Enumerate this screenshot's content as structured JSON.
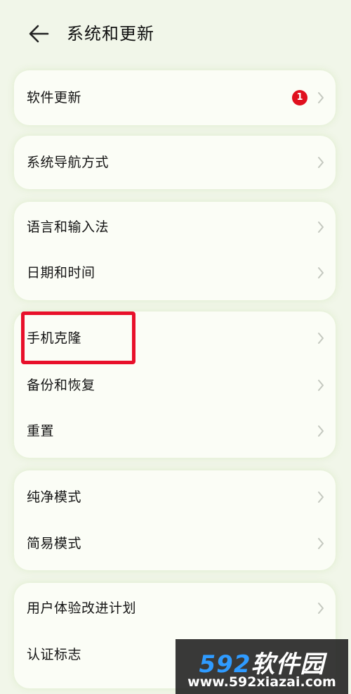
{
  "header": {
    "back_icon": "arrow-left-icon",
    "title": "系统和更新"
  },
  "groups": [
    {
      "items": [
        {
          "label": "软件更新",
          "badge": "1"
        }
      ]
    },
    {
      "items": [
        {
          "label": "系统导航方式"
        }
      ]
    },
    {
      "items": [
        {
          "label": "语言和输入法"
        },
        {
          "label": "日期和时间"
        }
      ]
    },
    {
      "items": [
        {
          "label": "手机克隆"
        },
        {
          "label": "备份和恢复"
        },
        {
          "label": "重置"
        }
      ]
    },
    {
      "items": [
        {
          "label": "纯净模式"
        },
        {
          "label": "简易模式"
        }
      ]
    },
    {
      "items": [
        {
          "label": "用户体验改进计划"
        },
        {
          "label": "认证标志"
        }
      ]
    }
  ],
  "watermark": {
    "logo_number": "592",
    "logo_text": "软件园",
    "url": "www.592xiazai.com"
  },
  "colors": {
    "background": "#f1f6e9",
    "card": "#fbfdf6",
    "badge": "#e0101e",
    "highlight": "#e8102a",
    "chevron": "#c4c8bf"
  }
}
